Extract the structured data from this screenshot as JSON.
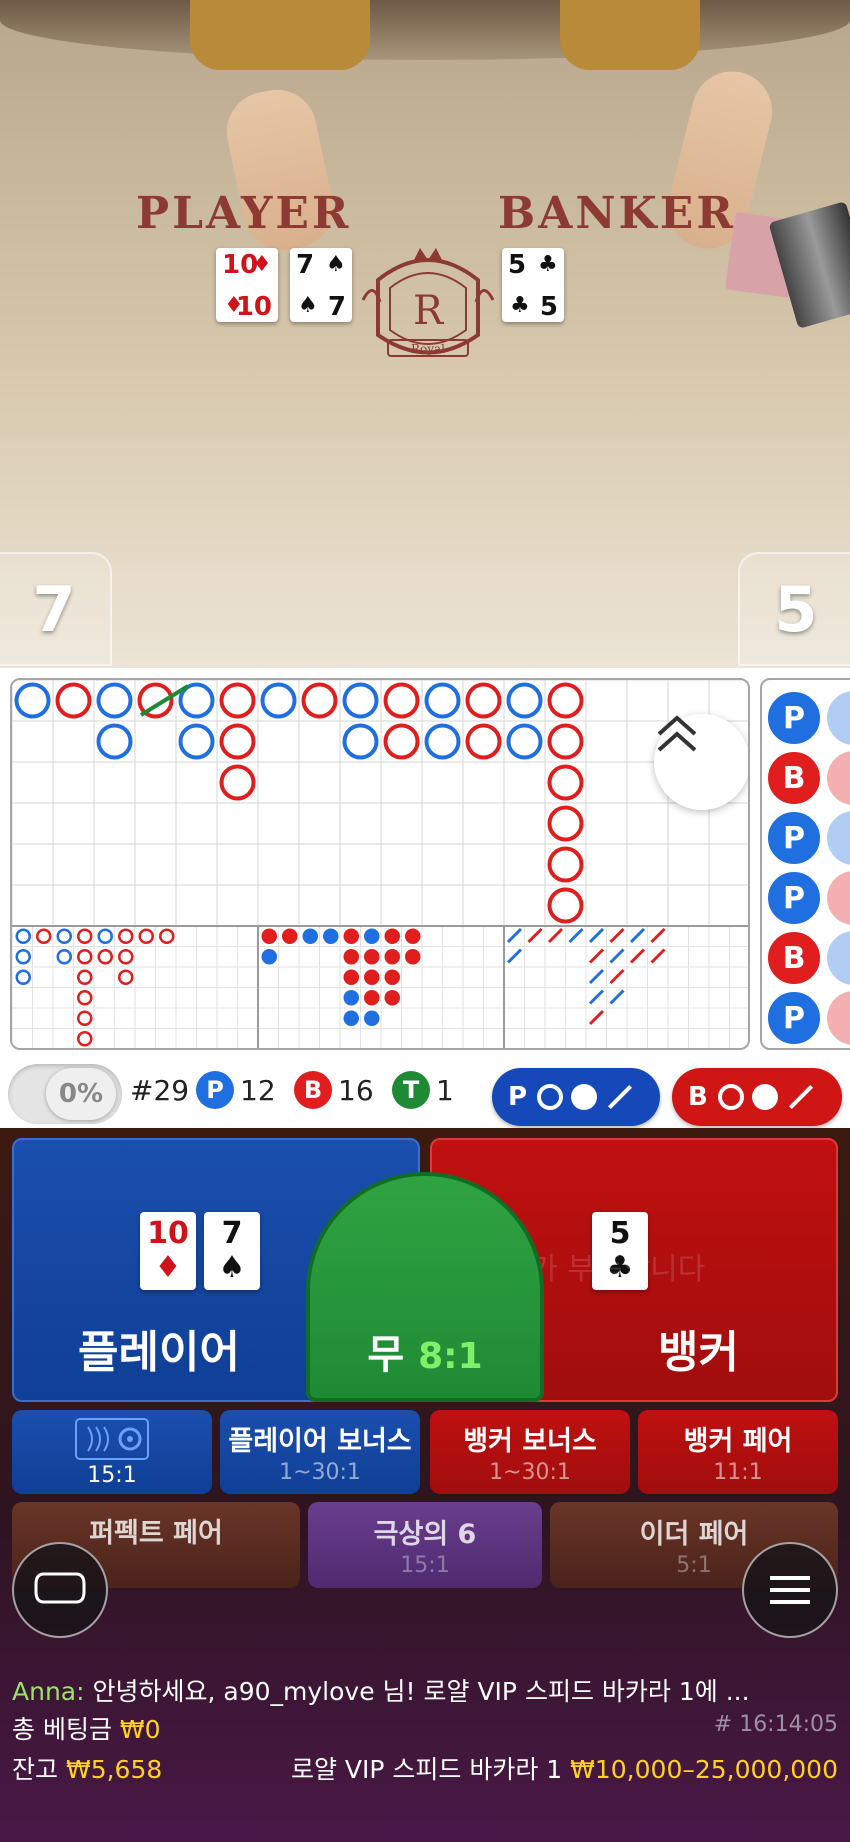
{
  "video": {
    "table_player_label": "PLAYER",
    "table_banker_label": "BANKER",
    "crest_letter": "R",
    "crest_text": "Royal",
    "player_score": "7",
    "banker_score": "5",
    "player_cards": [
      {
        "rank": "10",
        "suit": "♦",
        "color": "red"
      },
      {
        "rank": "7",
        "suit": "♠",
        "color": "black"
      }
    ],
    "banker_cards": [
      {
        "rank": "5",
        "suit": "♣",
        "color": "black"
      }
    ]
  },
  "colors": {
    "player_blue": "#1f6fe0",
    "banker_red": "#e01e1e",
    "tie_green": "#1f8a34",
    "gold": "#ffd21f"
  },
  "roadmap": {
    "big_road_cols": [
      [
        "P"
      ],
      [
        "B"
      ],
      [
        "P",
        "P"
      ],
      [
        "B"
      ],
      [
        "P",
        "P"
      ],
      [
        "B",
        "B",
        "B"
      ],
      [
        "P"
      ],
      [
        "B"
      ],
      [
        "P",
        "P"
      ],
      [
        "B",
        "B"
      ],
      [
        "P",
        "P"
      ],
      [
        "B",
        "B"
      ],
      [
        "P",
        "P"
      ],
      [
        "B",
        "B",
        "B",
        "B",
        "B",
        "B"
      ]
    ],
    "side_road": [
      "P",
      "B",
      "P",
      "P",
      "B",
      "P"
    ],
    "stats": {
      "toggle_percent": "0%",
      "round": "#29",
      "player_letter": "P",
      "player_count": "12",
      "banker_letter": "B",
      "banker_count": "16",
      "tie_letter": "T",
      "tie_count": "1"
    },
    "ask_player": "P",
    "ask_banker": "B"
  },
  "bets": {
    "player": {
      "name": "플레이어",
      "cards": [
        {
          "rank": "10",
          "suit": "♦",
          "color": "red"
        },
        {
          "rank": "7",
          "suit": "♠",
          "color": "black"
        }
      ]
    },
    "banker": {
      "name": "뱅커",
      "cards": [
        {
          "rank": "5",
          "suit": "♣",
          "color": "black"
        }
      ]
    },
    "tie": {
      "name": "무",
      "odds": "8:1"
    },
    "ghost_text": "잔고가 부족합니다",
    "side_bets": [
      {
        "name": "",
        "odds": "15:1"
      },
      {
        "name": "플레이어 보너스",
        "odds": "1~30:1"
      },
      {
        "name": "뱅커 보너스",
        "odds": "1~30:1"
      },
      {
        "name": "뱅커 페어",
        "odds": "11:1"
      }
    ],
    "lower_bets": [
      {
        "name": "퍼펙트 페어",
        "odds": ""
      },
      {
        "name": "극상의 6",
        "odds": "15:1"
      },
      {
        "name": "이더 페어",
        "odds": "5:1"
      }
    ]
  },
  "chat": {
    "user": "Anna:",
    "message": "안녕하세요, a90_mylove 님! 로얄 VIP 스피드 바카라 1에 ..."
  },
  "footer": {
    "total_bet_label": "총 베팅금",
    "total_bet_value": "₩0",
    "round_time": "# 16:14:05",
    "balance_label": "잔고",
    "balance_value": "₩5,658",
    "table_name": "로얄 VIP 스피드 바카라 1",
    "limits": "₩10,000–25,000,000"
  }
}
